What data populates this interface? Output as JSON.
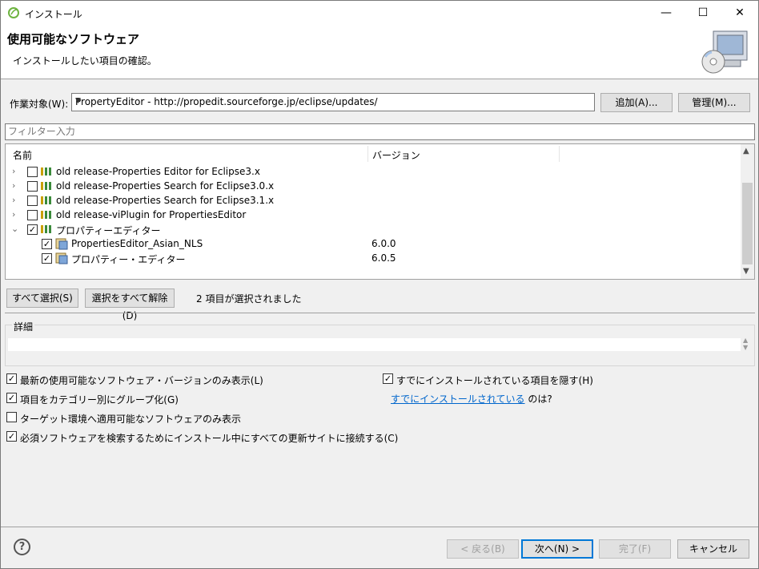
{
  "window": {
    "title": "インストール",
    "minimize": "—",
    "maximize": "☐",
    "close": "✕"
  },
  "banner": {
    "heading": "使用可能なソフトウェア",
    "subtitle": "インストールしたい項目の確認。"
  },
  "worktarget": {
    "label": "作業対象(W):",
    "value": "PropertyEditor - http://propedit.sourceforge.jp/eclipse/updates/",
    "add_label": "追加(A)...",
    "manage_label": "管理(M)..."
  },
  "filter": {
    "placeholder": "フィルター入力"
  },
  "tree": {
    "col_name": "名前",
    "col_version": "バージョン",
    "rows": [
      {
        "name": "old release-Properties Editor for Eclipse3.x",
        "version": "",
        "checked": false,
        "expanded": false,
        "level": 0
      },
      {
        "name": "old release-Properties Search for Eclipse3.0.x",
        "version": "",
        "checked": false,
        "expanded": false,
        "level": 0
      },
      {
        "name": "old release-Properties Search for Eclipse3.1.x",
        "version": "",
        "checked": false,
        "expanded": false,
        "level": 0
      },
      {
        "name": "old release-viPlugin for PropertiesEditor",
        "version": "",
        "checked": false,
        "expanded": false,
        "level": 0
      },
      {
        "name": "プロパティーエディター",
        "version": "",
        "checked": true,
        "expanded": true,
        "level": 0
      },
      {
        "name": "PropertiesEditor_Asian_NLS",
        "version": "6.0.0",
        "checked": true,
        "level": 1
      },
      {
        "name": "プロパティー・エディター",
        "version": "6.0.5",
        "checked": true,
        "level": 1
      }
    ]
  },
  "selection": {
    "select_all": "すべて選択(S)",
    "deselect_all": "選択をすべて解除(D)",
    "count_text": "2 項目が選択されました"
  },
  "details": {
    "caption": "詳細"
  },
  "options": {
    "latest_only": {
      "label": "最新の使用可能なソフトウェア・バージョンのみ表示(L)",
      "checked": true
    },
    "group_by_category": {
      "label": "項目をカテゴリー別にグループ化(G)",
      "checked": true
    },
    "target_env_only": {
      "label": "ターゲット環境へ適用可能なソフトウェアのみ表示",
      "checked": false
    },
    "contact_all_sites": {
      "label": "必須ソフトウェアを検索するためにインストール中にすべての更新サイトに接続する(C)",
      "checked": true
    },
    "hide_installed": {
      "label": "すでにインストールされている項目を隠す(H)",
      "checked": true
    },
    "installed_link": "すでにインストールされている",
    "installed_suffix": "のは?"
  },
  "footer": {
    "help": "?",
    "back": "< 戻る(B)",
    "next": "次へ(N) >",
    "finish": "完了(F)",
    "cancel": "キャンセル"
  },
  "colors": {
    "link": "#0066cc",
    "primary_border": "#0078d7"
  }
}
